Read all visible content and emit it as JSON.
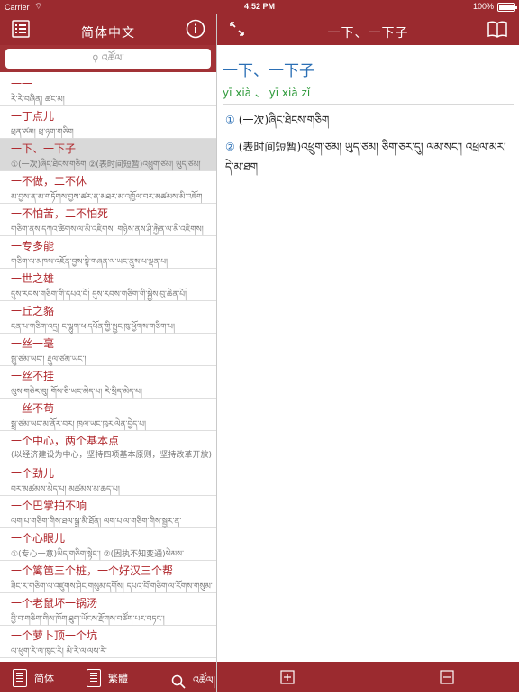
{
  "status": {
    "carrier": "Carrier",
    "wifi": "⌔",
    "time": "4:52 PM",
    "battery": "100%"
  },
  "left_header": {
    "title": "简体中文",
    "menu_icon": "list-icon",
    "info_icon": "info-icon"
  },
  "right_header": {
    "title": "一下、一下子",
    "expand_icon": "expand-arrows-icon",
    "book_icon": "book-icon"
  },
  "search": {
    "placeholder": "འཚོལ།"
  },
  "list": [
    {
      "word": "一一",
      "sub": "རེ་རེ་བཞིན། ཚང་མ།"
    },
    {
      "word": "一丁点儿",
      "sub": "ཕྲན་ཙམ། ཕྲ་ཉག་གཅིག"
    },
    {
      "word": "一下、一下子",
      "sub": "①(一次)ཞིང་ཐེངས་གཅིག ②(表时间短暂)འཕྲུག་ཙམ། ཡུད་ཙམ།",
      "selected": true
    },
    {
      "word": "一不做，二不休",
      "sub": "མ་བྱས་ན་མ་གཏོགས་བྱས་ཚར་ན་མཐར་མ་འཁྱོལ་བར་མཚམས་མི་འཇོག"
    },
    {
      "word": "一不怕苦，二不怕死",
      "sub": "གཅིག་ནས་དཀའ་ཚེགས་ལ་མི་འཇིགས། གཉིས་ནས་ཤི་རྐྱེན་ལ་མི་འཇིགས།"
    },
    {
      "word": "一专多能",
      "sub": "གཅིག་ལ་མཁས་འཇོན་བྱས་སྟེ་གཞན་ལ་ཡང་ནུས་པ་ལྡན་པ།"
    },
    {
      "word": "一世之雄",
      "sub": "དུས་རབས་གཅིག་གི་དཔའ་བོ། དུས་རབས་གཅིག་གི་སྐྱེས་བུ་ཆེན་པོ།"
    },
    {
      "word": "一丘之貉",
      "sub": "ངན་པ་གཅིག་འདྲ། ང་ལྷུག་ཕ་དཔོན་གྱི་སྤྱང་ཁུ་ཕྱོགས་གཅིག་པ།"
    },
    {
      "word": "一丝一毫",
      "sub": "སྤུ་ཙམ་ཡང་། རྡུལ་ཙམ་ཡང་།"
    },
    {
      "word": "一丝不挂",
      "sub": "ལུས་གཅེར་བུ། གོས་ཅི་ཡང་མེད་པ། རེ་སྲིད་མེད་པ།"
    },
    {
      "word": "一丝不苟",
      "sub": "སྤྲ་ཙམ་ཡང་མ་ནོར་བར། ཁྲལ་ཡང་ཁུར་ལེན་བྱེད་པ།"
    },
    {
      "word": "一个中心，两个基本点",
      "sub": "(以经济建设为中心，坚持四项基本原则，坚持改革开放)"
    },
    {
      "word": "一个劲儿",
      "sub": "བར་མཚམས་མེད་པ། མཚམས་མ་ཆད་པ།"
    },
    {
      "word": "一个巴掌拍不响",
      "sub": "ལག་པ་གཅིག་གིས་ཐལ་སྒྲ་མི་ཐོན། ལག་པ་ལ་གཅིག་གིས་སྦྱར་ན་"
    },
    {
      "word": "一个心眼儿",
      "sub": "①(专心一意)ཡིད་གཅིག་སྟེང་། ②(固执不知变通)སེམས་"
    },
    {
      "word": "一个篱笆三个桩，一个好汉三个帮",
      "sub": "ཟིང་ར་གཅིག་ལ་འཛུགས་ཤིང་གསུམ་དགོས། དཔའ་བོ་གཅིག་ལ་རོགས་གསུམ་"
    },
    {
      "word": "一个老鼠坏一锅汤",
      "sub": "བྱི་བ་གཅིག་གིས་ཁོག་ཐུག་ཡོངས་རྫོགས་བཙོག་པར་བཏང་།"
    },
    {
      "word": "一个萝卜顶一个坑",
      "sub": "ལ་ཕུག་རེ་ལ་ཁུང་རེ། མི་རེ་ལ་ལས་རེ་"
    }
  ],
  "detail": {
    "word": "一下、一下子",
    "pinyin": "yī xià 、 yī xià zǐ",
    "definitions": [
      {
        "num": "①",
        "text": "(一次)ཞིང་ཐེངས་གཅིག"
      },
      {
        "num": "②",
        "text": "(表时间短暂)འཕྲུག་ཙམ། ཡུད་ཙམ། ཅིག་ཅར་དུ། ལམ་སང་། འཕྲལ་མར། དེ་མ་ཐག"
      }
    ]
  },
  "tabs_left": [
    {
      "label": "简体",
      "icon": "book-icon"
    },
    {
      "label": "繁體",
      "icon": "book-icon"
    },
    {
      "label": "འཚོལ།",
      "icon": "search-icon"
    }
  ],
  "tabs_right": {
    "plus_icon": "zoom-in-icon",
    "minus_icon": "zoom-out-icon"
  }
}
